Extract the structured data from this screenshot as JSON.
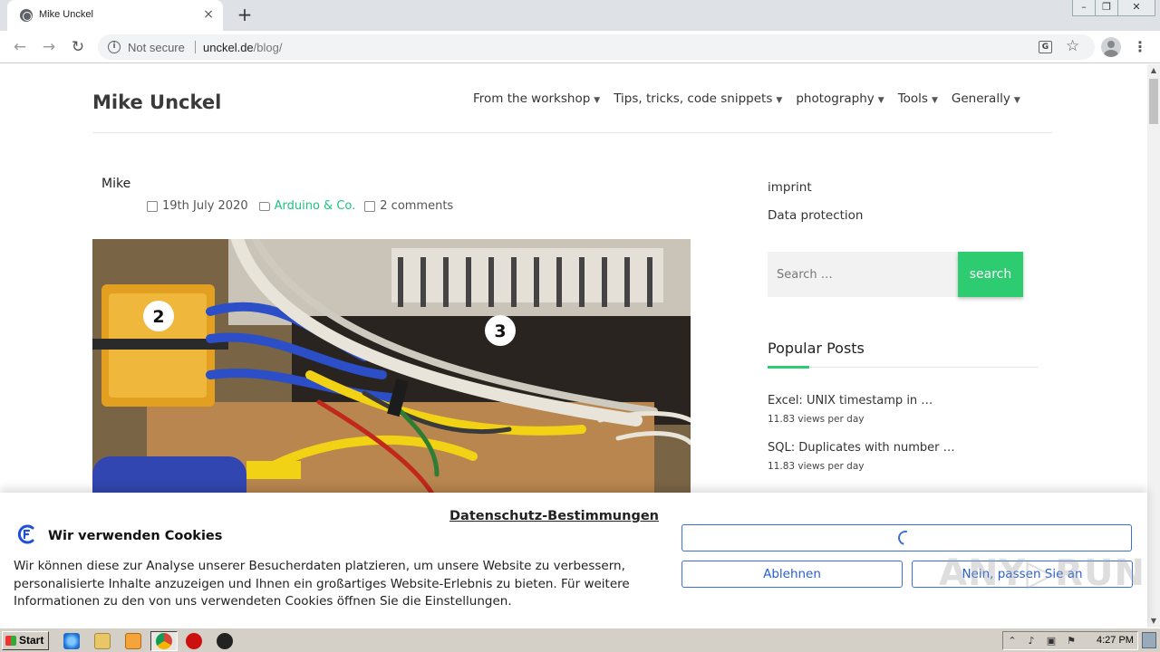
{
  "browser": {
    "tab_title": "Mike Unckel",
    "new_tab": "+",
    "tab_close": "×",
    "security_label": "Not secure",
    "url_host": "unckel.de",
    "url_path": "/blog/"
  },
  "site": {
    "title": "Mike Unckel",
    "nav": [
      {
        "label": "From the workshop"
      },
      {
        "label": "Tips, tricks, code snippets"
      },
      {
        "label": "photography"
      },
      {
        "label": "Tools"
      },
      {
        "label": "Generally"
      }
    ]
  },
  "post": {
    "author": "Mike",
    "date": "19th July 2020",
    "category": "Arduino & Co.",
    "comments": "2 comments",
    "image_labels": [
      "2",
      "3"
    ]
  },
  "sidebar": {
    "links": [
      "imprint",
      "Data protection"
    ],
    "search_placeholder": "Search …",
    "search_button": "search",
    "popular_title": "Popular Posts",
    "popular_posts": [
      {
        "title": "Excel: UNIX timestamp in …",
        "views": "11.83 views per day"
      },
      {
        "title": "SQL: Duplicates with number …",
        "views": "11.83 views per day"
      }
    ]
  },
  "cookie_banner": {
    "privacy_link": "Datenschutz-Bestimmungen",
    "title": "Wir verwenden Cookies",
    "text": "Wir können diese zur Analyse unserer Besucherdaten platzieren, um unsere Website zu verbessern, personalisierte Inhalte anzuzeigen und Ihnen ein großartiges Website-Erlebnis zu bieten. Für weitere Informationen zu den von uns verwendeten Cookies öffnen Sie die Einstellungen.",
    "reject_button": "Ablehnen",
    "customize_button": "Nein, passen Sie an",
    "watermark": "ANY▷RUN",
    "accent_color": "#3a70d8"
  },
  "taskbar": {
    "start_label": "Start",
    "clock": "4:27 PM"
  },
  "colors": {
    "accent_green": "#2ecc71",
    "category_green": "#1bc47d"
  }
}
